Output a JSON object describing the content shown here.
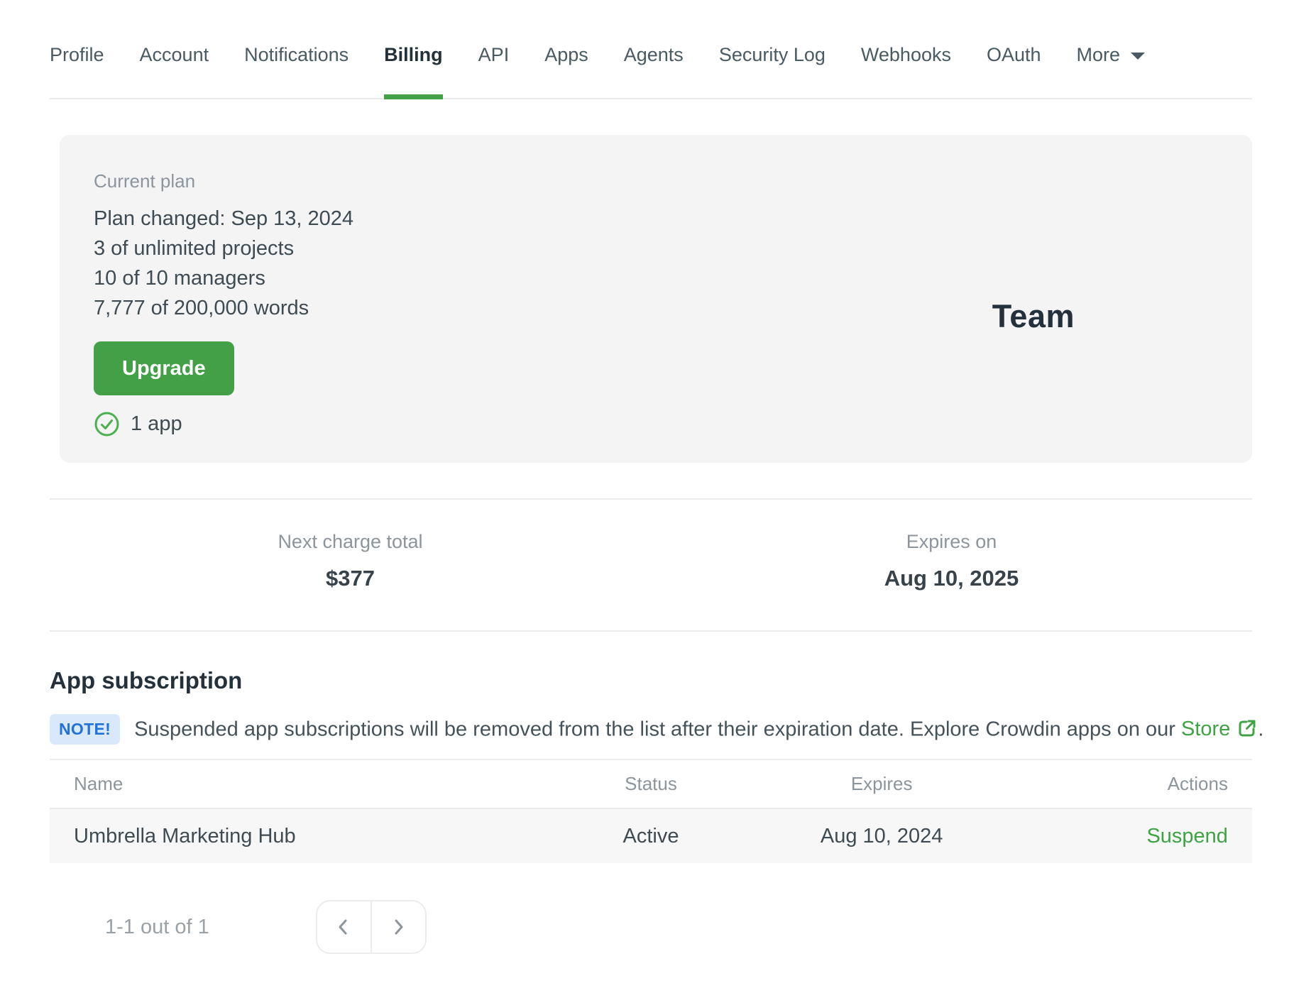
{
  "colors": {
    "accent_green": "#43a047",
    "link_green": "#3fa344",
    "note_badge_bg": "#d9e8fb",
    "note_badge_text": "#2273d8"
  },
  "tabs": {
    "items": [
      {
        "label": "Profile"
      },
      {
        "label": "Account"
      },
      {
        "label": "Notifications"
      },
      {
        "label": "Billing",
        "active": true
      },
      {
        "label": "API"
      },
      {
        "label": "Apps"
      },
      {
        "label": "Agents"
      },
      {
        "label": "Security Log"
      },
      {
        "label": "Webhooks"
      },
      {
        "label": "OAuth"
      },
      {
        "label": "More",
        "has_menu": true
      }
    ]
  },
  "plan_card": {
    "label": "Current plan",
    "lines": [
      "Plan changed: Sep 13, 2024",
      "3 of unlimited projects",
      "10 of 10 managers",
      "7,777 of 200,000 words"
    ],
    "upgrade_label": "Upgrade",
    "apps_label": "1 app",
    "plan_name": "Team"
  },
  "charge": {
    "next_charge_label": "Next charge total",
    "next_charge_value": "$377",
    "expires_label": "Expires on",
    "expires_value": "Aug 10, 2025"
  },
  "subscriptions": {
    "heading": "App subscription",
    "note_badge": "NOTE!",
    "note_text": "Suspended app subscriptions will be removed from the list after their expiration date. Explore Crowdin apps on our",
    "note_link": "Store",
    "note_suffix": ".",
    "table": {
      "headers": [
        "Name",
        "Status",
        "Expires",
        "Actions"
      ],
      "rows": [
        {
          "name": "Umbrella Marketing Hub",
          "status": "Active",
          "expires": "Aug 10, 2024",
          "action": "Suspend"
        }
      ]
    },
    "pagination": {
      "summary": "1-1 out of 1"
    }
  }
}
